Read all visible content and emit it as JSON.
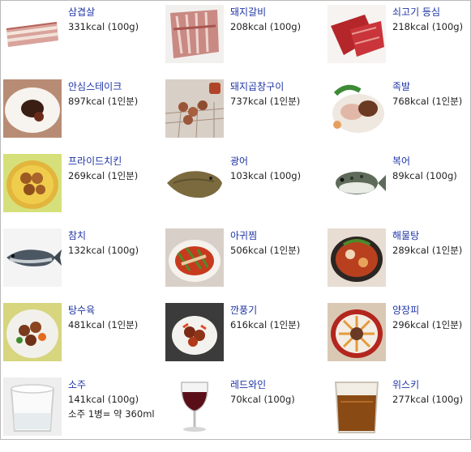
{
  "items": [
    {
      "name": "삼겹살",
      "cal": "331kcal (100g)"
    },
    {
      "name": "돼지갈비",
      "cal": "208kcal (100g)"
    },
    {
      "name": "쇠고기 등심",
      "cal": "218kcal (100g)"
    },
    {
      "name": "안심스테이크",
      "cal": "897kcal (1인분)"
    },
    {
      "name": "돼지곱창구이",
      "cal": "737kcal (1인분)"
    },
    {
      "name": "족발",
      "cal": "768kcal (1인분)"
    },
    {
      "name": "프라이드치킨",
      "cal": "269kcal (1인분)"
    },
    {
      "name": "광어",
      "cal": "103kcal (100g)"
    },
    {
      "name": "복어",
      "cal": "89kcal (100g)"
    },
    {
      "name": "참치",
      "cal": "132kcal (100g)"
    },
    {
      "name": "아귀찜",
      "cal": "506kcal (1인분)"
    },
    {
      "name": "해물탕",
      "cal": "289kcal (1인분)"
    },
    {
      "name": "탕수육",
      "cal": "481kcal (1인분)"
    },
    {
      "name": "깐풍기",
      "cal": "616kcal (1인분)"
    },
    {
      "name": "양장피",
      "cal": "296kcal (1인분)"
    },
    {
      "name": "소주",
      "cal": "141kcal (100g)",
      "note": "소주 1병= 약 360ml"
    },
    {
      "name": "레드와인",
      "cal": "70kcal (100g)"
    },
    {
      "name": "위스키",
      "cal": "277kcal (100g)"
    }
  ]
}
